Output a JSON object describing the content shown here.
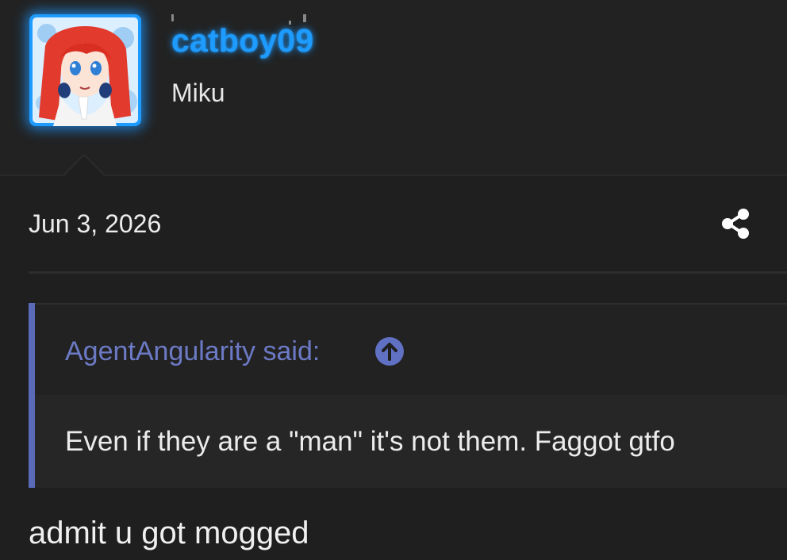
{
  "post": {
    "author": {
      "username": "catboy09",
      "user_title": "Miku",
      "avatar_icon": "anime-girl-avatar-icon"
    },
    "date": "Jun 3, 2026",
    "share_icon": "share-icon",
    "quote": {
      "author_label": "AgentAngularity said:",
      "jump_icon": "arrow-up-circle-icon",
      "text": "Even if they are a \"man\" it's not them. Faggot gtfo"
    },
    "body": "admit u got mogged"
  },
  "colors": {
    "background": "#1f1f1f",
    "username": "#1e9bff",
    "quote_accent": "#5a6ab8",
    "quote_author": "#6c7ac6",
    "text": "#ececec"
  }
}
